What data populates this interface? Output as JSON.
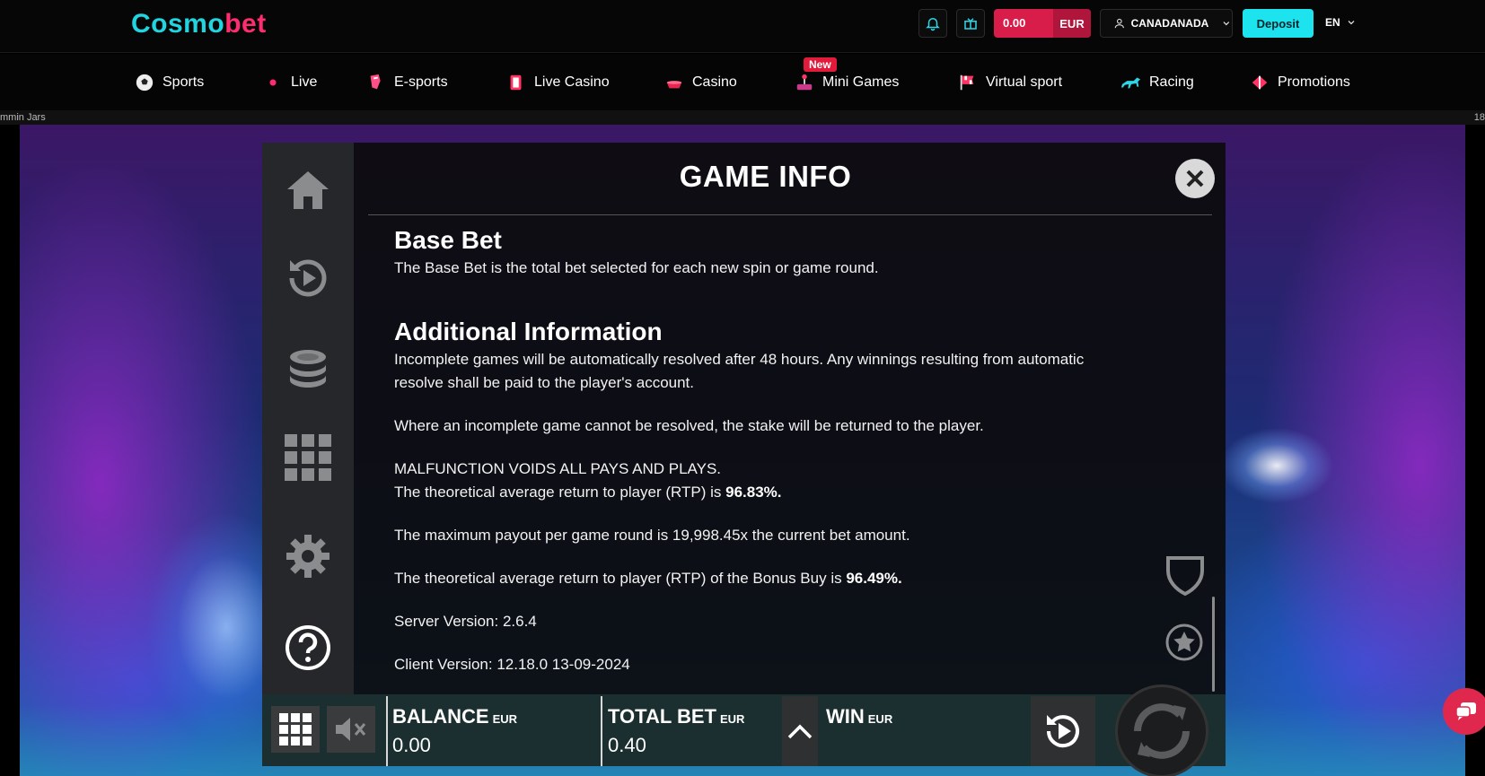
{
  "header": {
    "logo_part1": "Cosmo",
    "logo_part2": "bet",
    "balance_amount": "0.00",
    "balance_currency": "EUR",
    "username": "CANADANADA",
    "deposit_label": "Deposit",
    "language": "EN"
  },
  "nav": {
    "items": [
      {
        "label": "Sports",
        "icon": "soccer-ball-icon"
      },
      {
        "label": "Live",
        "icon": "live-dot-icon"
      },
      {
        "label": "E-sports",
        "icon": "esports-icon"
      },
      {
        "label": "Live Casino",
        "icon": "cards-icon"
      },
      {
        "label": "Casino",
        "icon": "casino-icon"
      },
      {
        "label": "Mini Games",
        "icon": "joystick-icon"
      },
      {
        "label": "Virtual sport",
        "icon": "checkered-flag-icon"
      },
      {
        "label": "Racing",
        "icon": "horse-icon"
      },
      {
        "label": "Promotions",
        "icon": "gift-icon"
      }
    ],
    "new_badge": "New"
  },
  "ticker": {
    "left": "mmin Jars",
    "right": "18"
  },
  "game_info": {
    "title": "GAME INFO",
    "base_bet_heading": "Base Bet",
    "base_bet_text": "The Base Bet is the total bet selected for each new spin or game round.",
    "additional_heading": "Additional Information",
    "para1": "Incomplete games will be automatically resolved after 48 hours. Any winnings resulting from automatic resolve shall be paid to the player's account.",
    "para2": "Where an incomplete game cannot be resolved, the stake will be returned to the player.",
    "para3": "MALFUNCTION VOIDS ALL PAYS AND PLAYS.",
    "rtp_prefix": "The theoretical average return to player (RTP) is ",
    "rtp_value": "96.83%.",
    "max_payout": "The maximum payout per game round is 19,998.45x the current bet amount.",
    "bonus_rtp_prefix": "The theoretical average return to player (RTP) of the Bonus Buy is ",
    "bonus_rtp_value": "96.49%.",
    "server_version": "Server Version: 2.6.4",
    "client_version": "Client Version: 12.18.0 13-09-2024"
  },
  "bottom_bar": {
    "balance_label": "BALANCE",
    "balance_currency": "EUR",
    "balance_value": "0.00",
    "total_bet_label": "TOTAL BET",
    "total_bet_currency": "EUR",
    "total_bet_value": "0.40",
    "win_label": "WIN",
    "win_currency": "EUR"
  }
}
